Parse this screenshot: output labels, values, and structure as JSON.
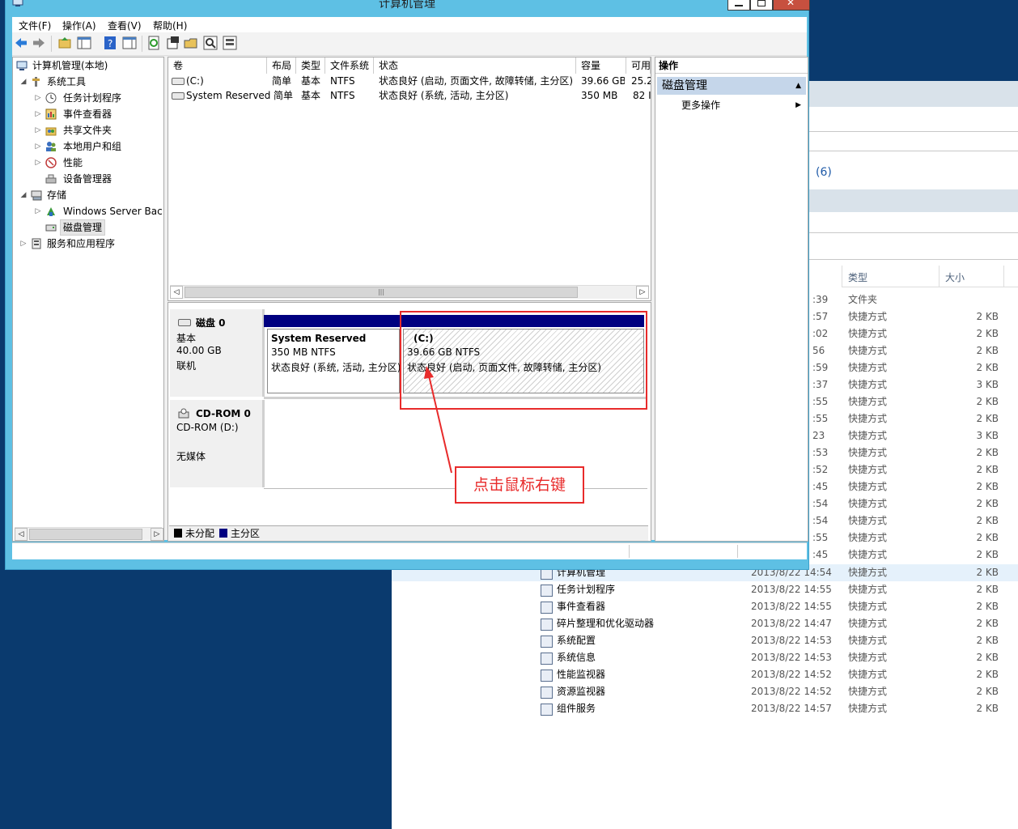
{
  "window": {
    "title": "计算机管理",
    "controls": [
      "minimize-icon",
      "maximize-icon",
      "close-icon"
    ]
  },
  "menu": [
    "文件(F)",
    "操作(A)",
    "查看(V)",
    "帮助(H)"
  ],
  "toolbar_icons": [
    "back-icon",
    "forward-icon",
    "up-folder-icon",
    "show-hide-tree-icon",
    "help-icon",
    "properties-panel-icon",
    "refresh-icon",
    "properties-icon",
    "open-icon",
    "search-icon",
    "settings-icon"
  ],
  "tree": {
    "root": "计算机管理(本地)",
    "system_tools": "系统工具",
    "task_scheduler": "任务计划程序",
    "event_viewer": "事件查看器",
    "shared_folders": "共享文件夹",
    "local_users": "本地用户和组",
    "performance": "性能",
    "device_manager": "设备管理器",
    "storage": "存储",
    "ws_backup": "Windows Server Back",
    "disk_mgmt": "磁盘管理",
    "services_apps": "服务和应用程序"
  },
  "volumes": {
    "headers": [
      "卷",
      "布局",
      "类型",
      "文件系统",
      "状态",
      "容量",
      "可用"
    ],
    "rows": [
      {
        "name": "(C:)",
        "layout": "简单",
        "type": "基本",
        "fs": "NTFS",
        "status": "状态良好 (启动, 页面文件, 故障转储, 主分区)",
        "capacity": "39.66 GB",
        "free": "25.2"
      },
      {
        "name": "System Reserved",
        "layout": "简单",
        "type": "基本",
        "fs": "NTFS",
        "status": "状态良好 (系统, 活动, 主分区)",
        "capacity": "350 MB",
        "free": "82 I"
      }
    ]
  },
  "disks": {
    "disk0": {
      "name": "磁盘 0",
      "type": "基本",
      "size": "40.00 GB",
      "state": "联机"
    },
    "part_sr": {
      "name": "System Reserved",
      "size": "350 MB NTFS",
      "status": "状态良好 (系统, 活动, 主分区)"
    },
    "part_c": {
      "name": "(C:)",
      "size": "39.66 GB NTFS",
      "status": "状态良好 (启动, 页面文件, 故障转储, 主分区)"
    },
    "cdrom": {
      "name": "CD-ROM 0",
      "drive": "CD-ROM (D:)",
      "media": "无媒体"
    }
  },
  "legend": {
    "unallocated": "未分配",
    "primary": "主分区",
    "unallocated_color": "#000000",
    "primary_color": "#000080"
  },
  "actions": {
    "header": "操作",
    "section": "磁盘管理",
    "more": "更多操作"
  },
  "annotation": {
    "text": "点击鼠标右键",
    "color": "#e82b2b"
  },
  "background_explorer": {
    "count_text": "(6)",
    "col_type": "类型",
    "col_size": "大小",
    "partial_rows": [
      {
        "time": ":39",
        "type": "文件夹",
        "size": ""
      },
      {
        "time": ":57",
        "type": "快捷方式",
        "size": "2 KB"
      },
      {
        "time": ":02",
        "type": "快捷方式",
        "size": "2 KB"
      },
      {
        "time": "56",
        "type": "快捷方式",
        "size": "2 KB"
      },
      {
        "time": ":59",
        "type": "快捷方式",
        "size": "2 KB"
      },
      {
        "time": ":37",
        "type": "快捷方式",
        "size": "3 KB"
      },
      {
        "time": ":55",
        "type": "快捷方式",
        "size": "2 KB"
      },
      {
        "time": ":55",
        "type": "快捷方式",
        "size": "2 KB"
      },
      {
        "time": "23",
        "type": "快捷方式",
        "size": "3 KB"
      },
      {
        "time": ":53",
        "type": "快捷方式",
        "size": "2 KB"
      },
      {
        "time": ":52",
        "type": "快捷方式",
        "size": "2 KB"
      },
      {
        "time": ":45",
        "type": "快捷方式",
        "size": "2 KB"
      },
      {
        "time": ":54",
        "type": "快捷方式",
        "size": "2 KB"
      },
      {
        "time": ":54",
        "type": "快捷方式",
        "size": "2 KB"
      },
      {
        "time": ":55",
        "type": "快捷方式",
        "size": "2 KB"
      },
      {
        "time": ":45",
        "type": "快捷方式",
        "size": "2 KB"
      }
    ],
    "full_rows": [
      {
        "name": "计算机管理",
        "time": "2013/8/22 14:54",
        "type": "快捷方式",
        "size": "2 KB"
      },
      {
        "name": "任务计划程序",
        "time": "2013/8/22 14:55",
        "type": "快捷方式",
        "size": "2 KB"
      },
      {
        "name": "事件查看器",
        "time": "2013/8/22 14:55",
        "type": "快捷方式",
        "size": "2 KB"
      },
      {
        "name": "碎片整理和优化驱动器",
        "time": "2013/8/22 14:47",
        "type": "快捷方式",
        "size": "2 KB"
      },
      {
        "name": "系统配置",
        "time": "2013/8/22 14:53",
        "type": "快捷方式",
        "size": "2 KB"
      },
      {
        "name": "系统信息",
        "time": "2013/8/22 14:53",
        "type": "快捷方式",
        "size": "2 KB"
      },
      {
        "name": "性能监视器",
        "time": "2013/8/22 14:52",
        "type": "快捷方式",
        "size": "2 KB"
      },
      {
        "name": "资源监视器",
        "time": "2013/8/22 14:52",
        "type": "快捷方式",
        "size": "2 KB"
      },
      {
        "name": "组件服务",
        "time": "2013/8/22 14:57",
        "type": "快捷方式",
        "size": "2 KB"
      }
    ]
  }
}
